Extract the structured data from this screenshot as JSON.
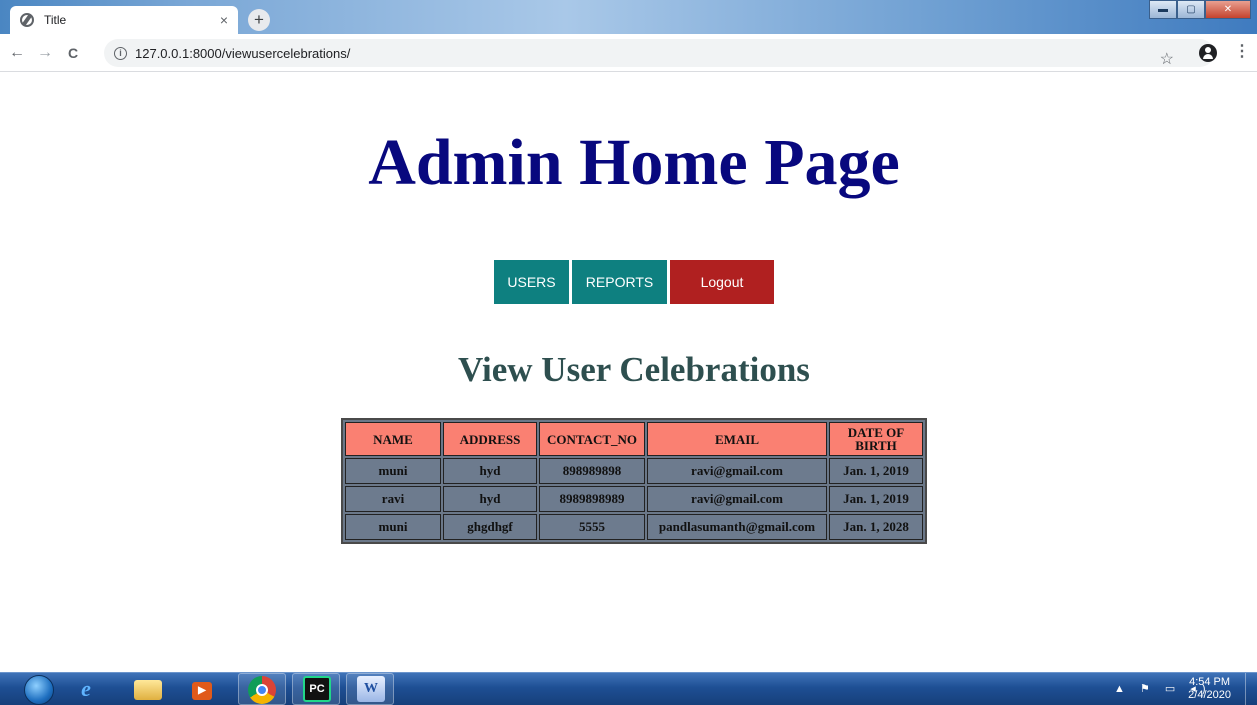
{
  "browser": {
    "tab_title": "Title",
    "tab_close": "×",
    "new_tab": "+",
    "url": "127.0.0.1:8000/viewusercelebrations/",
    "back": "←",
    "forward": "→",
    "reload": "C",
    "star": "☆",
    "menu": "⋮"
  },
  "page": {
    "title": "Admin Home Page",
    "nav": {
      "users": "USERS",
      "reports": "REPORTS",
      "logout": "Logout"
    },
    "section_title": "View User Celebrations",
    "table": {
      "headers": [
        "NAME",
        "ADDRESS",
        "CONTACT_NO",
        "EMAIL",
        "DATE OF BIRTH"
      ],
      "rows": [
        [
          "muni",
          "hyd",
          "898989898",
          "ravi@gmail.com",
          "Jan. 1, 2019"
        ],
        [
          "ravi",
          "hyd",
          "8989898989",
          "ravi@gmail.com",
          "Jan. 1, 2019"
        ],
        [
          "muni",
          "ghgdhgf",
          "5555",
          "pandlasumanth@gmail.com",
          "Jan. 1, 2028"
        ]
      ]
    }
  },
  "taskbar": {
    "time": "4:54 PM",
    "date": "2/4/2020",
    "pc_label": "PC"
  },
  "colors": {
    "title": "#08087e",
    "nav_teal": "#0e8080",
    "logout_red": "#b02020",
    "section_title": "#2e4f4f",
    "header_cell": "#fa8072",
    "body_cell": "#6d7b8e"
  },
  "icons": [
    "globe-icon",
    "back-arrow-icon",
    "forward-arrow-icon",
    "reload-icon",
    "info-icon",
    "star-icon",
    "account-icon",
    "menu-dots-icon",
    "start-orb-icon",
    "ie-icon",
    "explorer-icon",
    "media-player-icon",
    "chrome-icon",
    "pycharm-icon",
    "word-icon"
  ]
}
